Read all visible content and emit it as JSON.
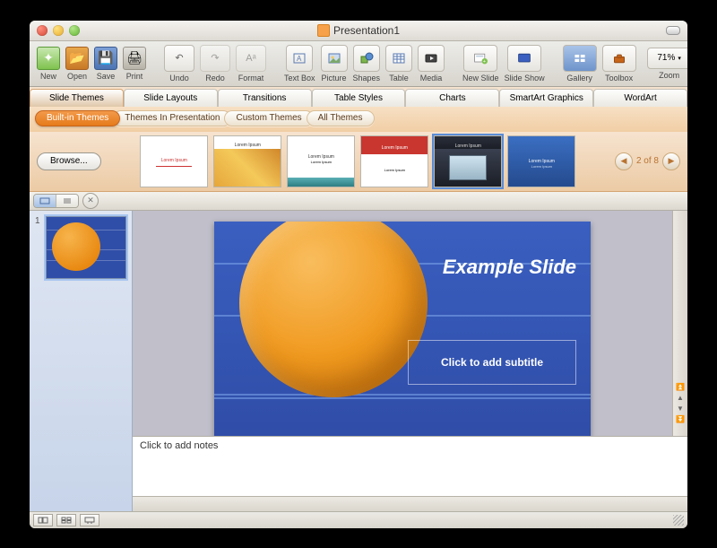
{
  "window": {
    "title": "Presentation1"
  },
  "toolbar": {
    "items": [
      {
        "id": "new",
        "label": "New"
      },
      {
        "id": "open",
        "label": "Open"
      },
      {
        "id": "save",
        "label": "Save"
      },
      {
        "id": "print",
        "label": "Print"
      },
      {
        "id": "undo",
        "label": "Undo"
      },
      {
        "id": "redo",
        "label": "Redo"
      },
      {
        "id": "format",
        "label": "Format"
      },
      {
        "id": "textbox",
        "label": "Text Box"
      },
      {
        "id": "picture",
        "label": "Picture"
      },
      {
        "id": "shapes",
        "label": "Shapes"
      },
      {
        "id": "table",
        "label": "Table"
      },
      {
        "id": "media",
        "label": "Media"
      },
      {
        "id": "newslide",
        "label": "New Slide"
      },
      {
        "id": "slideshow",
        "label": "Slide Show"
      },
      {
        "id": "gallery",
        "label": "Gallery"
      },
      {
        "id": "toolbox",
        "label": "Toolbox"
      }
    ],
    "zoom": {
      "value": "71%",
      "label": "Zoom"
    }
  },
  "ribbon": {
    "tabs": [
      "Slide Themes",
      "Slide Layouts",
      "Transitions",
      "Table Styles",
      "Charts",
      "SmartArt Graphics",
      "WordArt"
    ],
    "active": 0,
    "subtabs": [
      "Built-in Themes",
      "Themes In Presentation",
      "Custom Themes",
      "All Themes"
    ],
    "subactive": 0
  },
  "themeGallery": {
    "browse": "Browse...",
    "pager": {
      "current": 2,
      "total": 8,
      "label": "2 of 8"
    },
    "thumbs": [
      {
        "title": "Lorem Ipsum",
        "style": "white-red"
      },
      {
        "title": "Lorem Ipsum",
        "style": "gold-texture"
      },
      {
        "title": "Lorem Ipsum",
        "style": "white-teal"
      },
      {
        "title": "Lorem Ipsum",
        "style": "red-bar"
      },
      {
        "title": "Lorem Ipsum",
        "style": "dark-photo",
        "selected": true
      },
      {
        "title": "Lorem Ipsum",
        "style": "blue-gradient"
      }
    ]
  },
  "sidebar": {
    "slides": [
      {
        "number": "1"
      }
    ]
  },
  "canvas": {
    "title": "Example Slide",
    "subtitlePlaceholder": "Click to add subtitle"
  },
  "notes": {
    "placeholder": "Click to add notes"
  }
}
